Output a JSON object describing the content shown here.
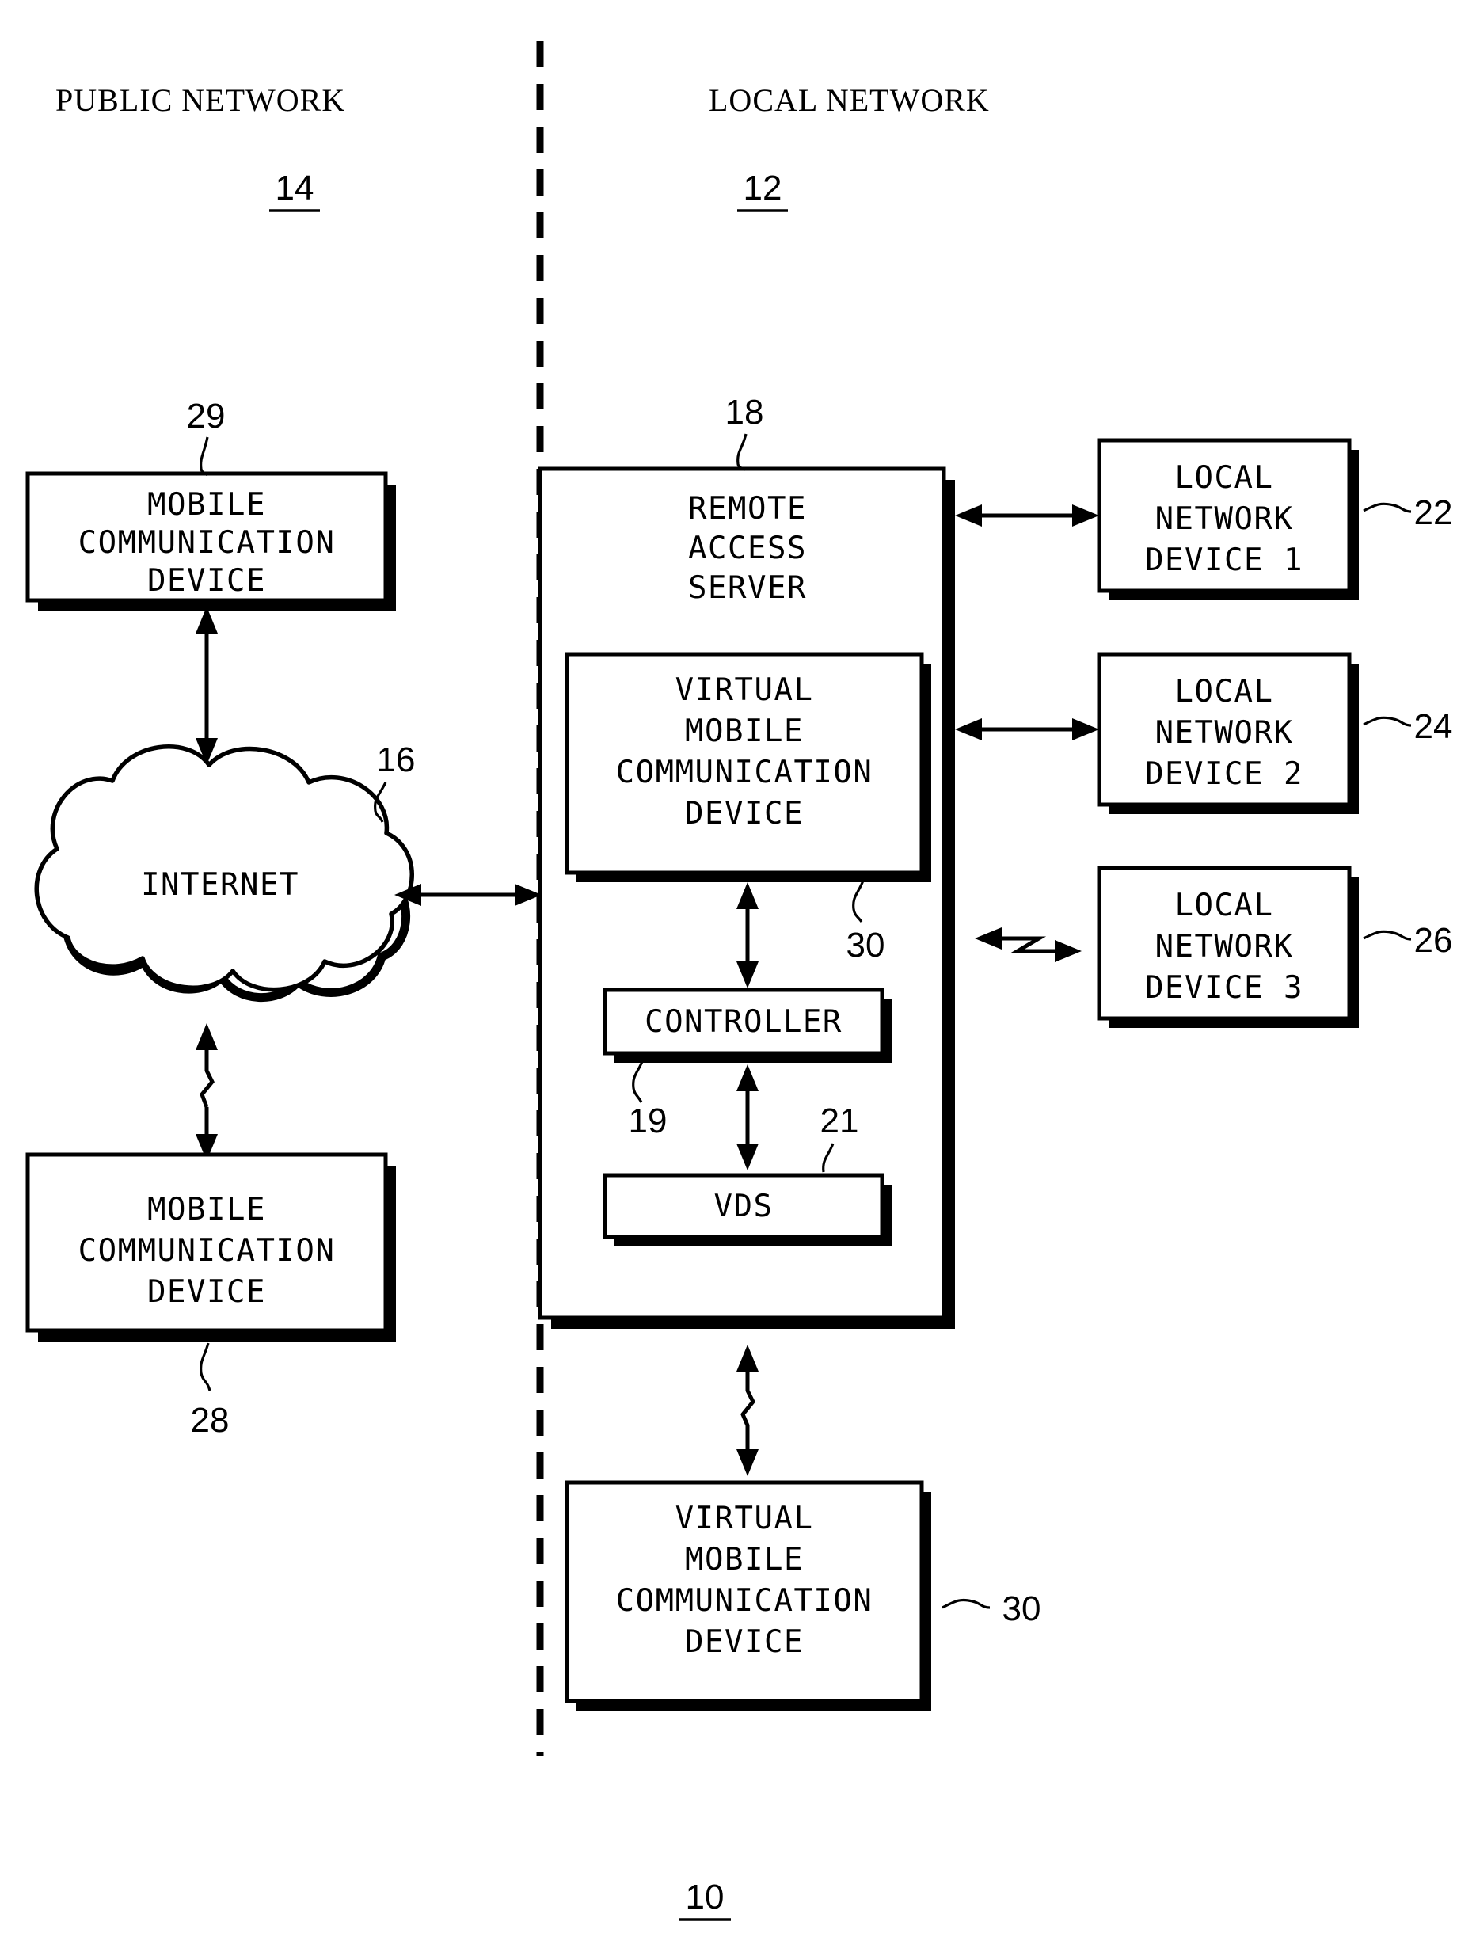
{
  "figure": {
    "figure_number": "10",
    "headers": {
      "public_network": "PUBLIC NETWORK",
      "local_network": "LOCAL NETWORK"
    },
    "section_refs": {
      "public_network": "14",
      "local_network": "12"
    }
  },
  "nodes": {
    "mobile_device_top": {
      "lines": [
        "MOBILE",
        "COMMUNICATION",
        "DEVICE"
      ],
      "ref": "29"
    },
    "internet_cloud": {
      "label": "INTERNET",
      "ref": "16"
    },
    "mobile_device_bottom": {
      "lines": [
        "MOBILE",
        "COMMUNICATION",
        "DEVICE"
      ],
      "ref": "28"
    },
    "remote_access_server": {
      "lines": [
        "REMOTE",
        "ACCESS",
        "SERVER"
      ],
      "ref": "18"
    },
    "virtual_mobile_device_inner": {
      "lines": [
        "VIRTUAL",
        "MOBILE",
        "COMMUNICATION",
        "DEVICE"
      ],
      "ref": "30"
    },
    "controller": {
      "label": "CONTROLLER",
      "ref": "19"
    },
    "vds": {
      "label": "VDS",
      "ref": "21"
    },
    "virtual_mobile_device_outer": {
      "lines": [
        "VIRTUAL",
        "MOBILE",
        "COMMUNICATION",
        "DEVICE"
      ],
      "ref": "30"
    },
    "local_network_device_1": {
      "lines": [
        "LOCAL",
        "NETWORK",
        "DEVICE 1"
      ],
      "ref": "22"
    },
    "local_network_device_2": {
      "lines": [
        "LOCAL",
        "NETWORK",
        "DEVICE 2"
      ],
      "ref": "24"
    },
    "local_network_device_3": {
      "lines": [
        "LOCAL",
        "NETWORK",
        "DEVICE 3"
      ],
      "ref": "26"
    }
  },
  "colors": {
    "ink": "#000000",
    "paper": "#ffffff"
  }
}
